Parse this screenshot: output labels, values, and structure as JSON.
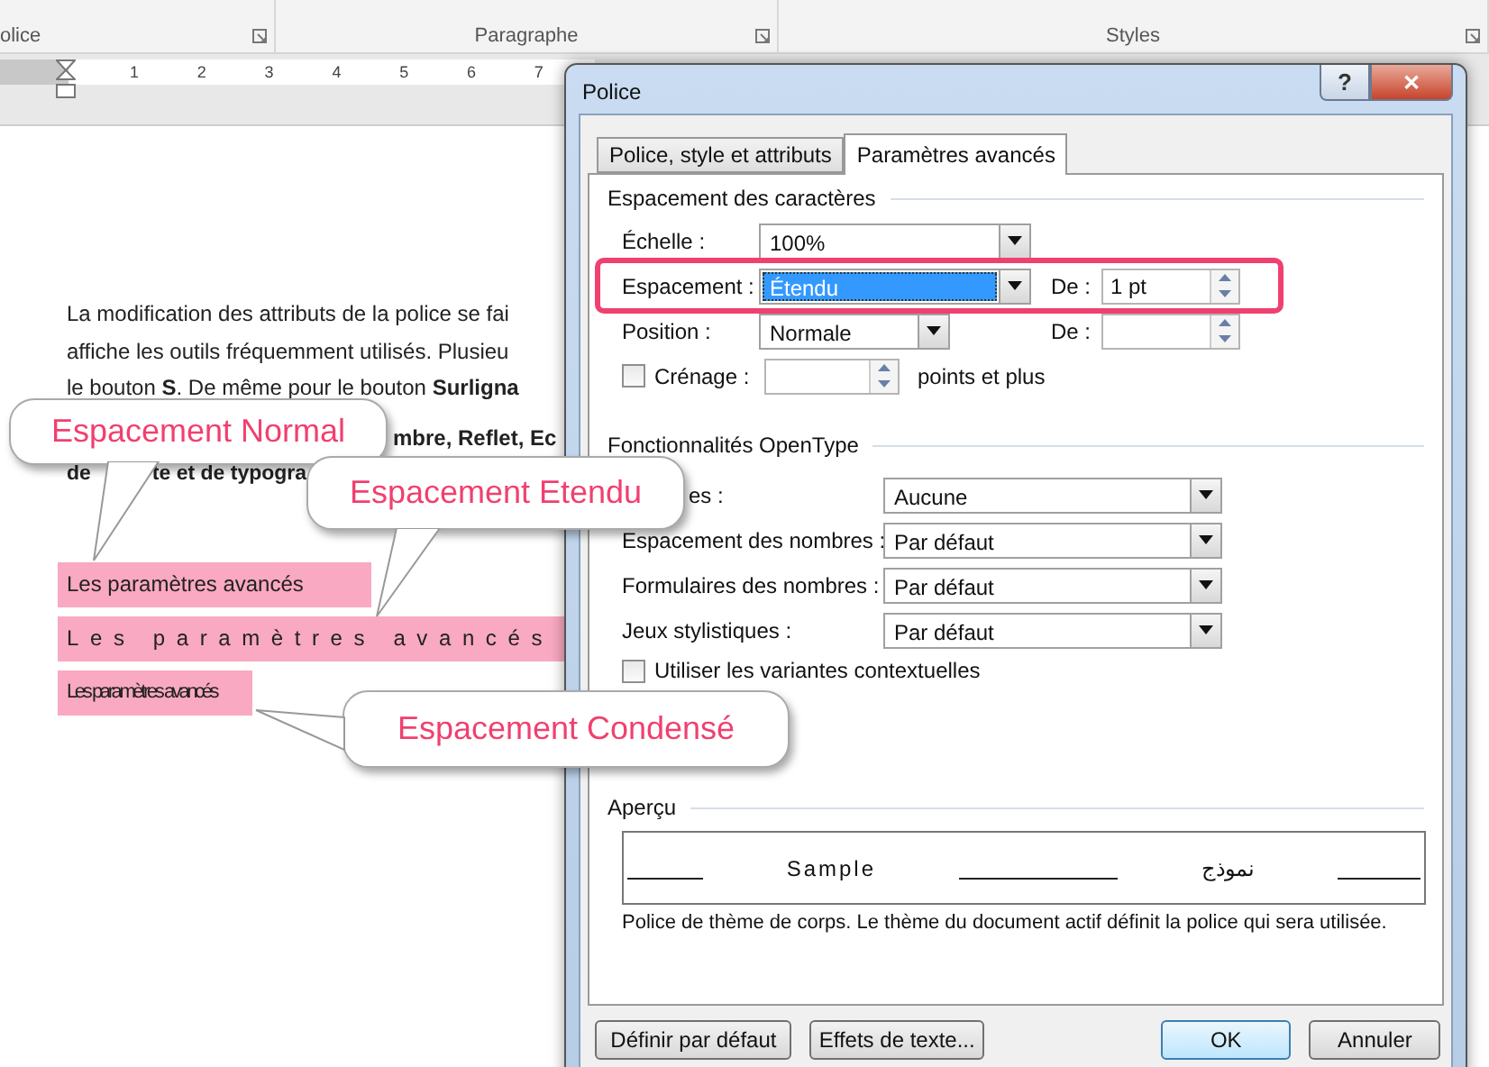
{
  "ribbon": {
    "groups": [
      {
        "label": "olice"
      },
      {
        "label": "Paragraphe"
      },
      {
        "label": "Styles"
      }
    ]
  },
  "ruler": {
    "numbers": [
      "1",
      "2",
      "3",
      "4",
      "5",
      "6",
      "7"
    ]
  },
  "document": {
    "lines": [
      {
        "parts": [
          "La modification des attributs de la police se fai"
        ]
      },
      {
        "parts": [
          "affiche les outils fréquemment utilisés. Plusieu"
        ]
      },
      {
        "parts": [
          "le bouton **S**. De même pour le bouton **Surligna**"
        ]
      },
      {
        "parts": [
          "**mbre, Reflet, Ec**"
        ]
      },
      {
        "parts": [
          "**de**",
          "**te et de typogra**"
        ]
      }
    ],
    "samples": [
      {
        "text": "Les paramètres avancés",
        "kind": "normal"
      },
      {
        "text": "Les paramètres avancés",
        "kind": "expanded"
      },
      {
        "text": "Les paramètres avancés",
        "kind": "condensed"
      }
    ]
  },
  "callouts": [
    {
      "text": "Espacement Normal",
      "kind": "normal"
    },
    {
      "text": "Espacement Etendu",
      "kind": "expanded"
    },
    {
      "text": "Espacement Condensé",
      "kind": "condensed"
    }
  ],
  "dialog": {
    "title": "Police",
    "help": "?",
    "close": "✕",
    "tabs": [
      {
        "label": "Police, style et attributs",
        "selected": false
      },
      {
        "label": "Paramètres avancés",
        "selected": true
      }
    ],
    "spacing": {
      "heading": "Espacement des caractères",
      "scale": {
        "label": "Échelle :",
        "value": "100%"
      },
      "spacing": {
        "label": "Espacement :",
        "value": "Étendu",
        "highlighted": true,
        "by_label": "De :",
        "by_value": "1 pt"
      },
      "position": {
        "label": "Position :",
        "value": "Normale",
        "by_label": "De :"
      },
      "kerning": {
        "label": "Crénage :",
        "checked": false,
        "suffix": "points et plus"
      }
    },
    "opentype": {
      "heading": "Fonctionnalités OpenType",
      "rows": [
        {
          "label": "es :",
          "value": "Aucune"
        },
        {
          "label": "Espacement des nombres :",
          "value": "Par défaut"
        },
        {
          "label": "Formulaires des nombres :",
          "value": "Par défaut"
        },
        {
          "label": "Jeux stylistiques :",
          "value": "Par défaut"
        }
      ],
      "contextual": {
        "label": "Utiliser les variantes contextuelles",
        "checked": false
      }
    },
    "preview": {
      "heading": "Aperçu",
      "sample": "Sample",
      "sample_arabic": "نموذج",
      "note": "Police de thème de corps. Le thème du document actif définit la police qui sera utilisée."
    },
    "buttons": [
      {
        "label": "Définir par défaut",
        "default": false
      },
      {
        "label": "Effets de texte...",
        "default": false
      },
      {
        "label": "OK",
        "default": true
      },
      {
        "label": "Annuler",
        "default": false
      }
    ]
  }
}
